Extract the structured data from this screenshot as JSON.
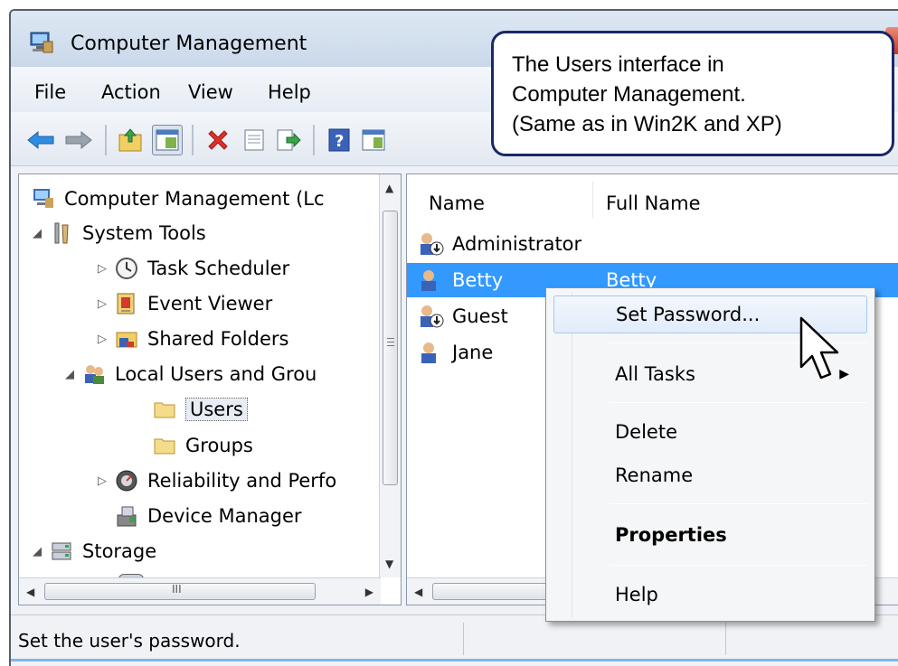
{
  "window": {
    "title": "Computer Management"
  },
  "menubar": {
    "items": [
      "File",
      "Action",
      "View",
      "Help"
    ]
  },
  "toolbar": {
    "buttons": [
      "back-icon",
      "forward-icon",
      "up-folder-icon",
      "show-hide-tree-icon",
      "delete-icon",
      "properties-icon",
      "export-icon",
      "help-icon",
      "mmc-icon"
    ]
  },
  "callout": {
    "lines": [
      "The Users interface in",
      "Computer Management.",
      "(Same as in Win2K and XP)"
    ]
  },
  "tree": {
    "items": [
      {
        "label": "Computer Management (Lc",
        "icon": "computer-management-icon",
        "expander": ""
      },
      {
        "label": "System Tools",
        "icon": "system-tools-icon",
        "expander": "expanded"
      },
      {
        "label": "Task Scheduler",
        "icon": "clock-icon",
        "expander": "collapsed"
      },
      {
        "label": "Event Viewer",
        "icon": "event-viewer-icon",
        "expander": "collapsed"
      },
      {
        "label": "Shared Folders",
        "icon": "shared-folders-icon",
        "expander": "collapsed"
      },
      {
        "label": "Local Users and Grou",
        "icon": "users-group-icon",
        "expander": "expanded"
      },
      {
        "label": "Users",
        "icon": "folder-icon",
        "expander": "",
        "selected": true
      },
      {
        "label": "Groups",
        "icon": "folder-icon",
        "expander": ""
      },
      {
        "label": "Reliability and Perfo",
        "icon": "reliability-icon",
        "expander": "collapsed"
      },
      {
        "label": "Device Manager",
        "icon": "device-manager-icon",
        "expander": ""
      },
      {
        "label": "Storage",
        "icon": "storage-icon",
        "expander": "expanded"
      }
    ],
    "hscroll_grip": "III"
  },
  "list": {
    "columns": [
      "Name",
      "Full Name"
    ],
    "rows": [
      {
        "name": "Administrator",
        "full_name": "",
        "disabled": true
      },
      {
        "name": "Betty",
        "full_name": "Betty",
        "selected": true
      },
      {
        "name": "Guest",
        "full_name": "",
        "disabled": true
      },
      {
        "name": "Jane",
        "full_name": ""
      }
    ]
  },
  "context_menu": {
    "items": [
      {
        "label": "Set Password...",
        "highlighted": true
      },
      {
        "label": "All Tasks",
        "submenu": true
      },
      {
        "label": "Delete"
      },
      {
        "label": "Rename"
      },
      {
        "label": "Properties",
        "bold": true
      },
      {
        "label": "Help"
      }
    ]
  },
  "statusbar": {
    "text": "Set the user's password."
  },
  "colors": {
    "selection": "#3399ff",
    "callout_border": "#1a2866"
  }
}
